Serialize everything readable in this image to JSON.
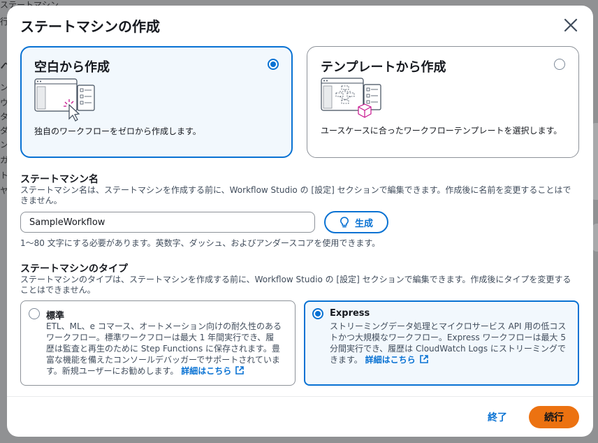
{
  "modal": {
    "title": "ステートマシンの作成",
    "close_icon": "close-icon"
  },
  "creation_options": [
    {
      "title": "空白から作成",
      "description": "独自のワークフローをゼロから作成します。",
      "selected": true,
      "icon": "blank-canvas-cursor-icon"
    },
    {
      "title": "テンプレートから作成",
      "description": "ユースケースに合ったワークフローテンプレートを選択します。",
      "selected": false,
      "icon": "template-flow-icon"
    }
  ],
  "name_section": {
    "label": "ステートマシン名",
    "description": "ステートマシン名は、ステートマシンを作成する前に、Workflow Studio の [設定] セクションで編集できます。作成後に名前を変更することはできません。",
    "input_value": "SampleWorkflow",
    "generate_label": "生成",
    "generate_icon": "lightbulb-icon",
    "hint": "1～80 文字にする必要があります。英数字、ダッシュ、およびアンダースコアを使用できます。"
  },
  "type_section": {
    "label": "ステートマシンのタイプ",
    "description": "ステートマシンのタイプは、ステートマシンを作成する前に、Workflow Studio の [設定] セクションで編集できます。作成後にタイプを変更することはできません。",
    "types": [
      {
        "title": "標準",
        "description": "ETL、ML、e コマース、オートメーション向けの耐久性のあるワークフロー。標準ワークフローは最大 1 年間実行でき、履歴は監査と再生のために Step Functions に保存されます。豊富な機能を備えたコンソールデバッガーでサポートされています。新規ユーザーにお勧めします。",
        "link": "詳細はこちら",
        "selected": false
      },
      {
        "title": "Express",
        "description": "ストリーミングデータ処理とマイクロサービス API 用の低コストかつ大規模なワークフロー。Express ワークフローは最大 5 分間実行でき、履歴は CloudWatch Logs にストリーミングできます。",
        "link": "詳細はこちら",
        "selected": true
      }
    ]
  },
  "footer": {
    "cancel_label": "終了",
    "continue_label": "続行"
  },
  "colors": {
    "accent": "#0972d3",
    "primary_button": "#ec7211",
    "selected_background": "#f2f8fd"
  },
  "background": {
    "fragments": [
      "ステートマシン",
      "行",
      "ベ",
      "ン",
      "ウ",
      "タ",
      "ダ",
      "ン",
      "ガ",
      "ト",
      "ヤ"
    ]
  }
}
